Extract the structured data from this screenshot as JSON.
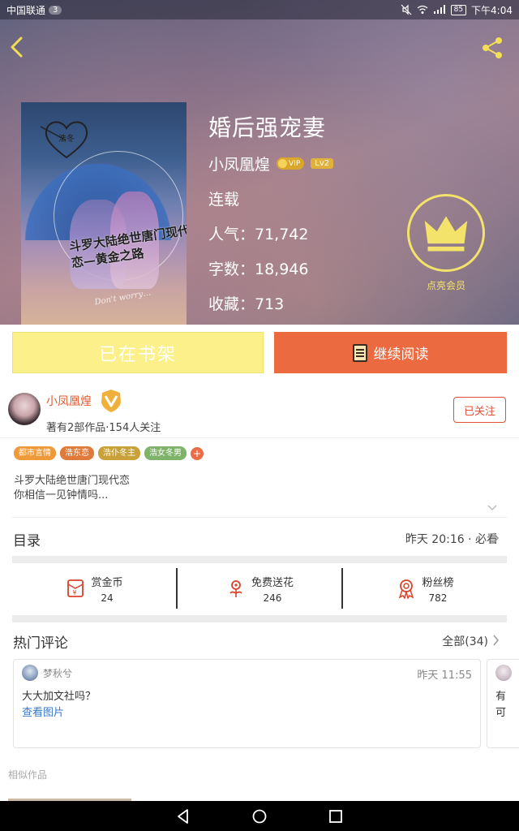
{
  "status_bar": {
    "carrier": "中国联通",
    "sim_count": "3",
    "battery": "85",
    "time": "下午4:04"
  },
  "book": {
    "title": "婚后强宠妻",
    "author": "小凤凰煌",
    "vip_label": "VIP",
    "level": "Lv2",
    "status": "连载",
    "popularity": "人气：71,742",
    "word_count": "字数：18,946",
    "favorites": "收藏：713",
    "cover_text": "斗罗大陆绝世唐门现代恋—黄金之路",
    "cover_heart_text": "浩冬",
    "cover_en": "Don't worry…"
  },
  "member": {
    "label": "点亮会员",
    "color": "#f4e36a"
  },
  "buttons": {
    "shelf_label": "已在书架",
    "read_label": "继续阅读"
  },
  "author_section": {
    "name": "小凤凰煌",
    "meta": "著有2部作品·154人关注",
    "follow_label": "已关注"
  },
  "tags": [
    {
      "label": "都市言情",
      "color": "#ef9a3a"
    },
    {
      "label": "浩东恋",
      "color": "#e07a3a"
    },
    {
      "label": "浩仆冬主",
      "color": "#c9a13a"
    },
    {
      "label": "浩女冬男",
      "color": "#7fb36a"
    }
  ],
  "description": {
    "line1": "斗罗大陆绝世唐门现代恋",
    "line2": "你相信一见钟情吗..."
  },
  "catalog": {
    "label": "目录",
    "update": "昨天 20:16 · 必看"
  },
  "stats": [
    {
      "label": "赏金币",
      "value": "24",
      "icon": "coin-envelope-icon"
    },
    {
      "label": "免费送花",
      "value": "246",
      "icon": "flower-icon"
    },
    {
      "label": "粉丝榜",
      "value": "782",
      "icon": "medal-icon"
    }
  ],
  "comments": {
    "label": "热门评论",
    "all": "全部(34)",
    "items": [
      {
        "user": "梦秋兮",
        "time": "昨天 11:55",
        "text": "大大加文社吗？",
        "link": "查看图片"
      },
      {
        "text": "有",
        "text2": "可"
      }
    ]
  },
  "similar": {
    "label": "相似作品"
  },
  "colors": {
    "accent_orange": "#ec6a3f",
    "shelf_yellow": "#fbf089",
    "link_blue": "#3a79c8"
  }
}
